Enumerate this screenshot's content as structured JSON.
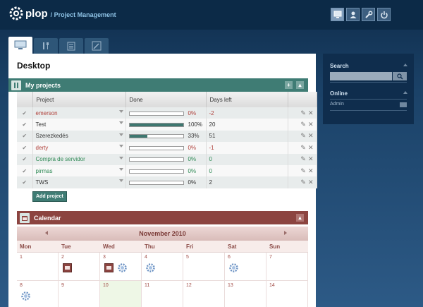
{
  "app": {
    "name": "plop",
    "subtitle": "/ Project Management"
  },
  "top_icons": [
    {
      "name": "monitor-icon",
      "active": true
    },
    {
      "name": "user-icon",
      "active": false
    },
    {
      "name": "wrench-icon",
      "active": false
    },
    {
      "name": "power-icon",
      "active": false
    }
  ],
  "tabs": [
    {
      "name": "desktop",
      "icon": "monitor-icon",
      "active": true
    },
    {
      "name": "tools",
      "icon": "tools-icon",
      "active": false
    },
    {
      "name": "notes",
      "icon": "clipboard-icon",
      "active": false
    },
    {
      "name": "edit",
      "icon": "pencil-icon",
      "active": false
    }
  ],
  "page": {
    "title": "Desktop"
  },
  "projects": {
    "title": "My projects",
    "columns": [
      "Project",
      "Done",
      "Days left"
    ],
    "rows": [
      {
        "name": "emerson",
        "done": 0,
        "done_label": "0%",
        "days": "-2",
        "color": "red"
      },
      {
        "name": "Test",
        "done": 100,
        "done_label": "100%",
        "days": "20",
        "color": "dark"
      },
      {
        "name": "Szerezkedés",
        "done": 33,
        "done_label": "33%",
        "days": "51",
        "color": "dark"
      },
      {
        "name": "derty",
        "done": 0,
        "done_label": "0%",
        "days": "-1",
        "color": "red"
      },
      {
        "name": "Compra de servidor",
        "done": 0,
        "done_label": "0%",
        "days": "0",
        "color": "green"
      },
      {
        "name": "pirmas",
        "done": 0,
        "done_label": "0%",
        "days": "0",
        "color": "green"
      },
      {
        "name": "TWS",
        "done": 0,
        "done_label": "0%",
        "days": "2",
        "color": "dark"
      }
    ],
    "add_label": "Add project"
  },
  "calendar": {
    "title": "Calendar",
    "month": "November 2010",
    "weekdays": [
      "Mon",
      "Tue",
      "Wed",
      "Thu",
      "Fri",
      "Sat",
      "Sun"
    ],
    "weeks": [
      [
        {
          "day": "1",
          "icons": []
        },
        {
          "day": "2",
          "icons": [
            "event"
          ]
        },
        {
          "day": "3",
          "icons": [
            "event",
            "gear"
          ]
        },
        {
          "day": "4",
          "icons": [
            "gear"
          ]
        },
        {
          "day": "5",
          "icons": []
        },
        {
          "day": "6",
          "icons": [
            "gear"
          ]
        },
        {
          "day": "7",
          "icons": []
        }
      ],
      [
        {
          "day": "8",
          "icons": [
            "gear"
          ]
        },
        {
          "day": "9",
          "icons": []
        },
        {
          "day": "10",
          "icons": [],
          "today": true
        },
        {
          "day": "11",
          "icons": []
        },
        {
          "day": "12",
          "icons": []
        },
        {
          "day": "13",
          "icons": []
        },
        {
          "day": "14",
          "icons": []
        }
      ]
    ]
  },
  "sidebar": {
    "search_label": "Search",
    "search_placeholder": "",
    "online_label": "Online",
    "online_users": [
      "Admin"
    ]
  },
  "colors": {
    "accent_green": "#3f7c74",
    "accent_red": "#8c4440",
    "bg_dark": "#0f2d4c"
  }
}
